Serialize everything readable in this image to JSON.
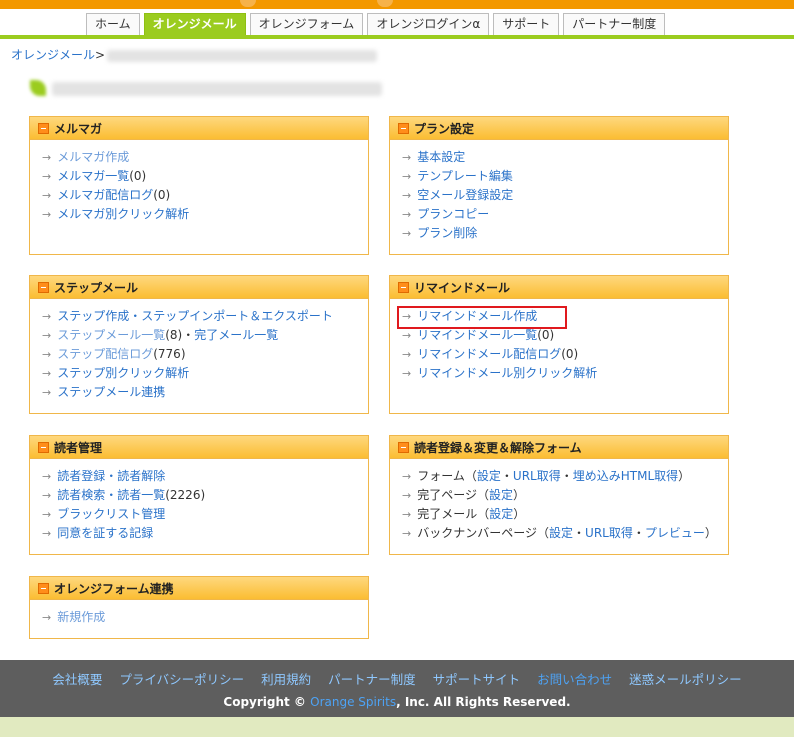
{
  "nav": {
    "tabs": [
      "ホーム",
      "オレンジメール",
      "オレンジフォーム",
      "オレンジログインα",
      "サポート",
      "パートナー制度"
    ],
    "active_tab": "オレンジメール"
  },
  "breadcrumb": {
    "home": "オレンジメール",
    "separator": ">"
  },
  "panels": {
    "magazine": {
      "title": "メルマガ",
      "items": [
        {
          "label": "メルマガ作成",
          "count": ""
        },
        {
          "label": "メルマガ一覧",
          "count": "(0)"
        },
        {
          "label": "メルマガ配信ログ",
          "count": "(0)"
        },
        {
          "label": "メルマガ別クリック解析",
          "count": ""
        }
      ]
    },
    "plan": {
      "title": "プラン設定",
      "items": [
        "基本設定",
        "テンプレート編集",
        "空メール登録設定",
        "プランコピー",
        "プラン削除"
      ]
    },
    "step": {
      "title": "ステップメール",
      "items": {
        "create": "ステップ作成・ステップインポート＆エクスポート",
        "list": "ステップメール一覧",
        "list_count": "(8)",
        "dot": "・",
        "complete": "完了メール一覧",
        "log": "ステップ配信ログ",
        "log_count": "(776)",
        "click": "ステップ別クリック解析",
        "link": "ステップメール連携"
      }
    },
    "remind": {
      "title": "リマインドメール",
      "items": [
        {
          "label": "リマインドメール作成",
          "count": ""
        },
        {
          "label": "リマインドメール一覧",
          "count": "(0)"
        },
        {
          "label": "リマインドメール配信ログ",
          "count": "(0)"
        },
        {
          "label": "リマインドメール別クリック解析",
          "count": ""
        }
      ]
    },
    "readers": {
      "title": "読者管理",
      "items": [
        {
          "label": "読者登録・読者解除",
          "count": ""
        },
        {
          "label": "読者検索・読者一覧",
          "count": "(2226)"
        },
        {
          "label": "ブラックリスト管理",
          "count": ""
        },
        {
          "label": "同意を証する記録",
          "count": ""
        }
      ]
    },
    "forms": {
      "title": "読者登録＆変更＆解除フォーム",
      "form_label": "フォーム",
      "complete_page_label": "完了ページ",
      "complete_mail_label": "完了メール",
      "backnumber_label": "バックナンバーページ",
      "open_paren": "（",
      "close_paren": "）",
      "sep": "・",
      "settings": "設定",
      "get_url": "URL取得",
      "embed_html": "埋め込みHTML取得",
      "preview": "プレビュー"
    },
    "orange_form": {
      "title": "オレンジフォーム連携",
      "items": [
        "新規作成"
      ]
    }
  },
  "footer": {
    "links": [
      "会社概要",
      "プライバシーポリシー",
      "利用規約",
      "パートナー制度",
      "サポートサイト",
      "お問い合わせ",
      "迷惑メールポリシー"
    ],
    "copyright_prefix": "Copyright ©",
    "company": "Orange Spirits",
    "copyright_suffix": ", Inc. All Rights Reserved."
  },
  "colors": {
    "accent_orange": "#f39800",
    "accent_green": "#9bcc1f",
    "link_blue": "#2a72c9",
    "highlight_red": "#e0191e",
    "footer_gray": "#5e5e5e"
  },
  "icons": {
    "list_arrow": "→",
    "panel_header": "minus-box-icon"
  }
}
